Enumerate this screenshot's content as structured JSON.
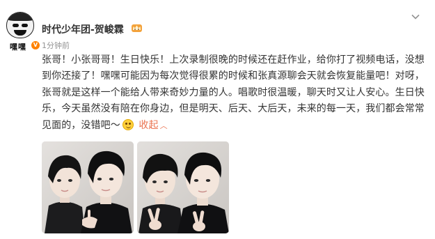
{
  "post": {
    "author": {
      "name": "时代少年团-贺峻霖",
      "avatar_caption": "嘿嘿",
      "crown_icon": "crown-icon",
      "verified_icon": "verified-badge-icon",
      "verified_color": "#ff8200"
    },
    "timestamp": "1分钟前",
    "more_icon": "chevron-down-icon",
    "text": "张哥！小张哥哥！生日快乐！上次录制很晚的时候还在赶作业，给你打了视频电话，没想到你还接了！嘿嘿可能因为每次觉得很累的时候和张真源聊会天就会恢复能量吧！对呀，张哥就是这样一个能给人带来奇妙力量的人。唱歌时很温暖，聊天时又让人安心。生日快乐，今天虽然没有陪在你身边，但是明天、后天、大后天，未来的每一天，我们都会常常见面的，没错吧～",
    "emoji_icon": "smile-emoji-icon",
    "collapse_label": "收起",
    "collapse_icon": "chevron-up-icon",
    "link_color": "#eb7350",
    "photos": [
      {
        "name": "photo-1",
        "icon": "photo-two-people"
      },
      {
        "name": "photo-2",
        "icon": "photo-two-people-v-sign"
      }
    ]
  }
}
